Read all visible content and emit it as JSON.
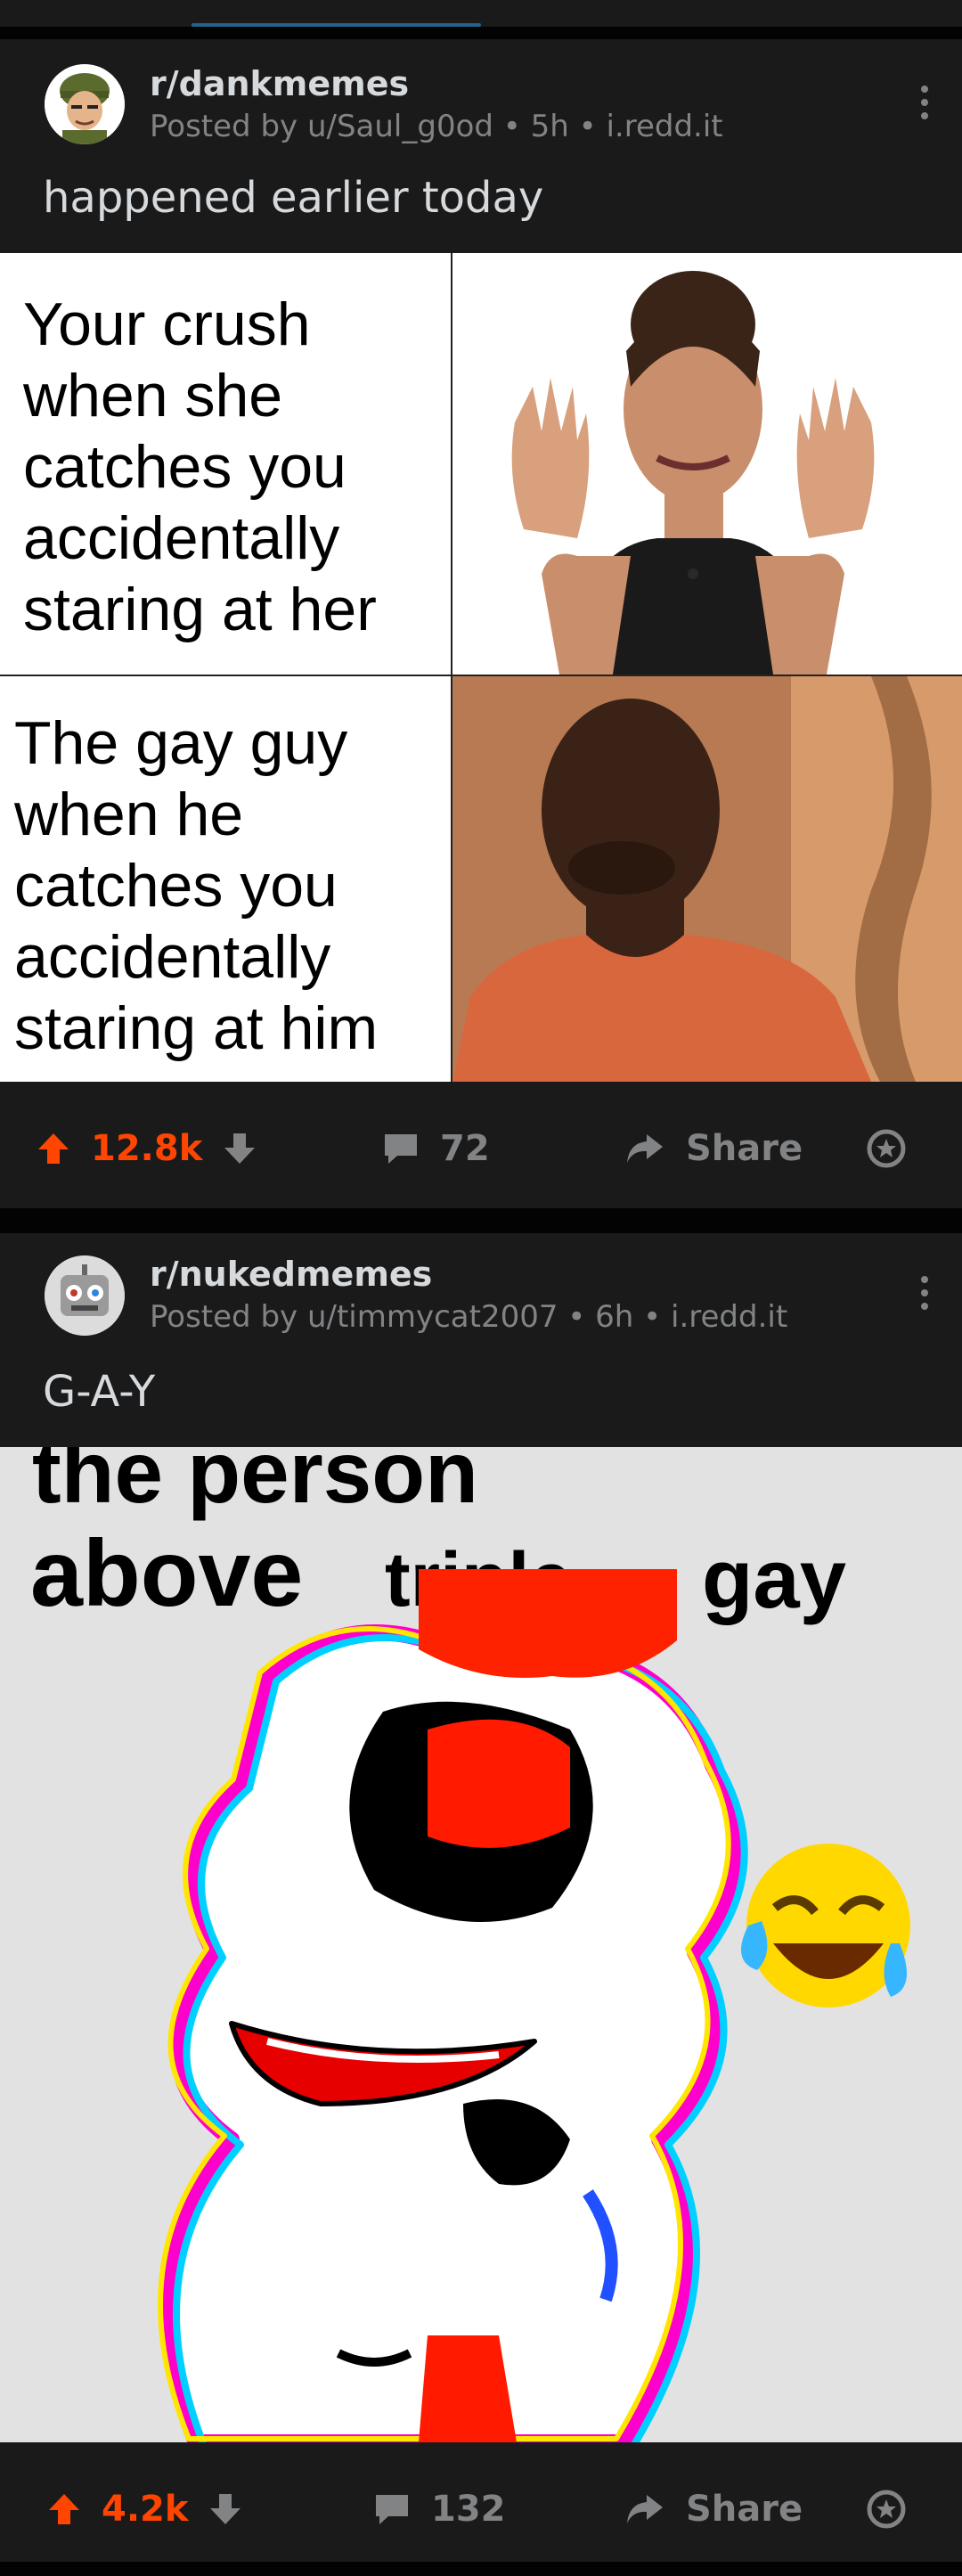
{
  "posts": [
    {
      "subreddit": "r/dankmemes",
      "meta": "Posted by u/Saul_g0od • 5h • i.redd.it",
      "title": "happened earlier today",
      "meme": {
        "top_text": "Your crush\nwhen she\ncatches you\naccidentally\nstaring at her",
        "bottom_text": "The gay guy\nwhen he\ncatches you\naccidentally\nstaring at him"
      },
      "score": "12.8k",
      "comments": "72",
      "share_label": "Share"
    },
    {
      "subreddit": "r/nukedmemes",
      "meta": "Posted by u/timmycat2007 • 6h • i.redd.it",
      "title": "G-A-Y",
      "meme": {
        "line1": "the person",
        "line2a": "above",
        "line2b": "triple",
        "line2c": "gay"
      },
      "score": "4.2k",
      "comments": "132",
      "share_label": "Share"
    }
  ],
  "colors": {
    "upvote_active": "#ff4500",
    "muted": "#818384",
    "card_bg": "#1a1a1b",
    "page_bg": "#030303"
  },
  "icons": [
    "upvote-arrow-icon",
    "downvote-arrow-icon",
    "comment-bubble-icon",
    "share-arrow-icon",
    "award-icon",
    "more-options-icon"
  ]
}
